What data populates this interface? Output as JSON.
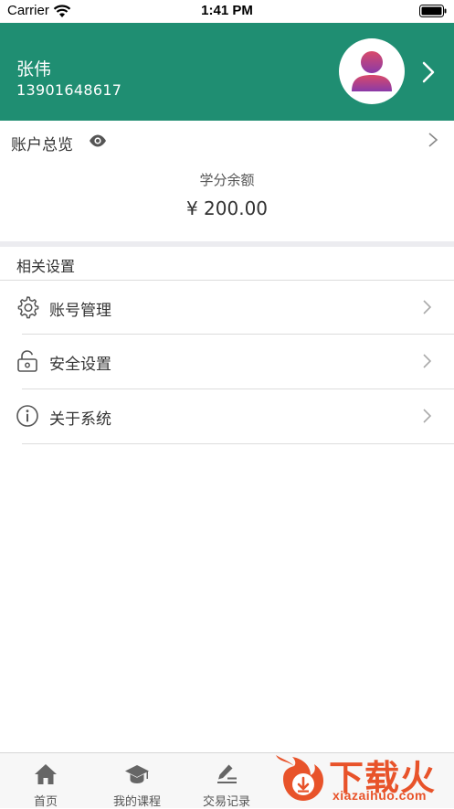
{
  "status_bar": {
    "carrier": "Carrier",
    "time": "1:41 PM"
  },
  "profile": {
    "name": "张伟",
    "phone": "13901648617",
    "avatar_icon": "user-avatar-icon",
    "header_color": "#1f8e72"
  },
  "overview": {
    "title": "账户总览",
    "balance_label": "学分余额",
    "balance_value": "¥ 200.00"
  },
  "settings": {
    "title": "相关设置",
    "items": [
      {
        "label": "账号管理",
        "icon": "gear-icon"
      },
      {
        "label": "安全设置",
        "icon": "unlock-icon"
      },
      {
        "label": "关于系统",
        "icon": "info-icon"
      }
    ]
  },
  "tab_bar": {
    "tabs": [
      {
        "label": "首页",
        "icon": "home-icon"
      },
      {
        "label": "我的课程",
        "icon": "graduation-cap-icon"
      },
      {
        "label": "交易记录",
        "icon": "edit-icon"
      }
    ]
  },
  "watermark": {
    "text": "下载火",
    "subtext": "xiazaihuo.com",
    "color": "#e8532a"
  }
}
